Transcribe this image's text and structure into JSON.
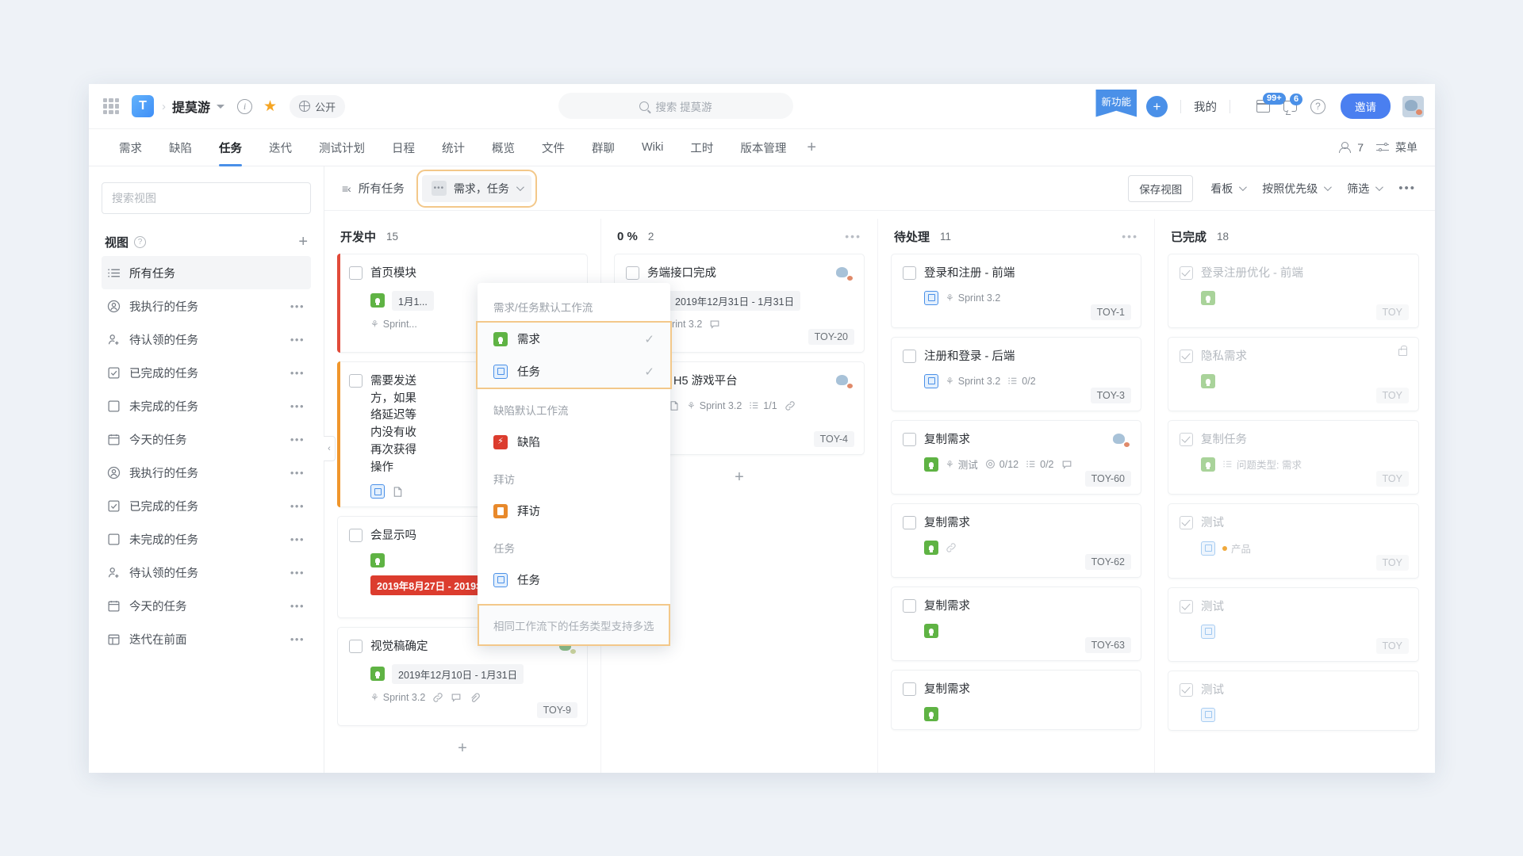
{
  "header": {
    "apps_icon": "grid-apps-icon",
    "project_logo": "T",
    "project_name": "提莫游",
    "info_icon": "i",
    "star_icon": "★",
    "visibility_label": "公开",
    "search_placeholder": "搜索 提莫游",
    "new_feature_badge": "新功能",
    "add_button": "+",
    "mine_label": "我的",
    "calendar_badge": "99+",
    "message_badge": "6",
    "help_icon": "?",
    "invite_label": "邀请"
  },
  "nav": {
    "tabs": [
      {
        "label": "需求",
        "active": false
      },
      {
        "label": "缺陷",
        "active": false
      },
      {
        "label": "任务",
        "active": true
      },
      {
        "label": "迭代",
        "active": false
      },
      {
        "label": "测试计划",
        "active": false
      },
      {
        "label": "日程",
        "active": false
      },
      {
        "label": "统计",
        "active": false
      },
      {
        "label": "概览",
        "active": false
      },
      {
        "label": "文件",
        "active": false
      },
      {
        "label": "群聊",
        "active": false
      },
      {
        "label": "Wiki",
        "active": false
      },
      {
        "label": "工时",
        "active": false
      },
      {
        "label": "版本管理",
        "active": false
      }
    ],
    "add_tab": "+",
    "member_count": "7",
    "menu_label": "菜单"
  },
  "sidebar": {
    "search_placeholder": "搜索视图",
    "section_title": "视图",
    "add_view": "+",
    "items": [
      {
        "label": "所有任务",
        "icon": "list-icon",
        "selected": true,
        "dots": ""
      },
      {
        "label": "我执行的任务",
        "icon": "user-circle-icon",
        "selected": false,
        "dots": "•••"
      },
      {
        "label": "待认领的任务",
        "icon": "user-plus-icon",
        "selected": false,
        "dots": "•••"
      },
      {
        "label": "已完成的任务",
        "icon": "checkbox-checked-icon",
        "selected": false,
        "dots": "•••"
      },
      {
        "label": "未完成的任务",
        "icon": "checkbox-empty-icon",
        "selected": false,
        "dots": "•••"
      },
      {
        "label": "今天的任务",
        "icon": "calendar-icon",
        "selected": false,
        "dots": "•••"
      },
      {
        "label": "我执行的任务",
        "icon": "user-circle-icon",
        "selected": false,
        "dots": "•••"
      },
      {
        "label": "已完成的任务",
        "icon": "checkbox-checked-icon",
        "selected": false,
        "dots": "•••"
      },
      {
        "label": "未完成的任务",
        "icon": "checkbox-empty-icon",
        "selected": false,
        "dots": "•••"
      },
      {
        "label": "待认领的任务",
        "icon": "user-plus-icon",
        "selected": false,
        "dots": "•••"
      },
      {
        "label": "今天的任务",
        "icon": "calendar-icon",
        "selected": false,
        "dots": "•••"
      },
      {
        "label": "迭代在前面",
        "icon": "layout-icon",
        "selected": false,
        "dots": "•••"
      }
    ]
  },
  "toolbar": {
    "collapse_icon": "≡‹",
    "view_title": "所有任务",
    "type_filter_label": "需求，任务",
    "save_view_label": "保存视图",
    "board_label": "看板",
    "sort_label": "按照优先级",
    "filter_label": "筛选",
    "more_label": "•••"
  },
  "dropdown": {
    "groups": [
      {
        "label": "需求/任务默认工作流",
        "highlighted": true,
        "items": [
          {
            "label": "需求",
            "icon": "bulb-icon",
            "color": "green",
            "checked": true
          },
          {
            "label": "任务",
            "icon": "checkbox-icon",
            "color": "blue",
            "checked": true
          }
        ]
      },
      {
        "label": "缺陷默认工作流",
        "highlighted": false,
        "items": [
          {
            "label": "缺陷",
            "icon": "bolt-icon",
            "color": "red",
            "checked": false
          }
        ]
      },
      {
        "label": "拜访",
        "highlighted": false,
        "items": [
          {
            "label": "拜访",
            "icon": "clipboard-icon",
            "color": "orange",
            "checked": false
          }
        ]
      },
      {
        "label": "任务",
        "highlighted": false,
        "items": [
          {
            "label": "任务",
            "icon": "checkbox-icon",
            "color": "blue",
            "checked": false
          }
        ]
      }
    ],
    "footer_note": "相同工作流下的任务类型支持多选"
  },
  "board": {
    "columns": [
      {
        "name": "开发中",
        "count": "15",
        "dots": "",
        "cards": [
          {
            "title": "首页模块",
            "stripe": "red",
            "type_icon": "bulb-icon",
            "type_color": "green",
            "date": "1月1...",
            "sprint": "Sprint...",
            "id": "",
            "done": false,
            "muted": false
          },
          {
            "title": "需要发送\n方，如果\n络延迟等\n内没有收\n再次获得\n操作",
            "stripe": "orange",
            "type_icon": "checkbox-icon",
            "type_color": "blue",
            "date": "",
            "sprint": "",
            "id": "",
            "done": false,
            "muted": false
          },
          {
            "title": "会显示吗",
            "stripe": "none",
            "type_icon": "bulb-icon",
            "type_color": "green",
            "date": "2019年8月27日 - 2019年8月31日",
            "date_overdue": true,
            "sprint": "",
            "id": "TOY-59",
            "done": false,
            "muted": false
          },
          {
            "title": "视觉稿确定",
            "stripe": "none",
            "type_icon": "bulb-icon",
            "type_color": "green",
            "date": "2019年12月10日 - 1月31日",
            "sprint": "Sprint 3.2",
            "extras": [
              "link-icon",
              "comment-icon",
              "attachment-icon"
            ],
            "avatar": "green",
            "id": "TOY-9",
            "done": false,
            "muted": false
          }
        ],
        "add_label": "+"
      },
      {
        "name": "0 %",
        "count": "2",
        "dots": "•••",
        "cards": [
          {
            "title": "务端接口完成",
            "stripe": "none",
            "type_icon": "bulb-icon",
            "type_color": "green",
            "date": "2019年12月31日 - 1月31日",
            "sprint": "Sprint 3.2",
            "extras": [
              "comment-icon"
            ],
            "avatar": "blue",
            "id": "TOY-20",
            "done": false,
            "muted": false
          },
          {
            "title": "调研 H5 游戏平台",
            "stripe": "none",
            "type_icon": "bulb-icon",
            "type_color": "green",
            "date": "",
            "sprint": "Sprint 3.2",
            "checklist": "1/1",
            "extras": [
              "doc-icon",
              "link-icon",
              "comment-icon"
            ],
            "avatar": "blue",
            "id": "TOY-4",
            "done": false,
            "muted": false
          }
        ],
        "add_label": "+"
      },
      {
        "name": "待处理",
        "count": "11",
        "dots": "•••",
        "cards": [
          {
            "title": "登录和注册 - 前端",
            "stripe": "none",
            "type_icon": "checkbox-icon",
            "type_color": "blue",
            "date": "",
            "sprint": "Sprint 3.2",
            "id": "TOY-1",
            "done": false,
            "muted": false
          },
          {
            "title": "注册和登录 - 后端",
            "stripe": "none",
            "type_icon": "checkbox-icon",
            "type_color": "blue",
            "date": "",
            "sprint": "Sprint 3.2",
            "checklist": "0/2",
            "id": "TOY-3",
            "done": false,
            "muted": false
          },
          {
            "title": "复制需求",
            "stripe": "none",
            "type_icon": "bulb-icon",
            "type_color": "green",
            "date": "",
            "sprint": "测试",
            "progress": "0/12",
            "checklist": "0/2",
            "extras": [
              "comment-icon"
            ],
            "avatar": "blue",
            "id": "TOY-60",
            "done": false,
            "muted": false
          },
          {
            "title": "复制需求",
            "stripe": "none",
            "type_icon": "bulb-icon",
            "type_color": "green",
            "date": "",
            "sprint": "",
            "extras": [
              "link-icon"
            ],
            "id": "TOY-62",
            "done": false,
            "muted": false
          },
          {
            "title": "复制需求",
            "stripe": "none",
            "type_icon": "bulb-icon",
            "type_color": "green",
            "date": "",
            "sprint": "",
            "id": "TOY-63",
            "done": false,
            "muted": false
          },
          {
            "title": "复制需求",
            "stripe": "none",
            "type_icon": "bulb-icon",
            "type_color": "green",
            "date": "",
            "sprint": "",
            "id": "",
            "done": false,
            "muted": false
          }
        ],
        "add_label": "+"
      },
      {
        "name": "已完成",
        "count": "18",
        "dots": "",
        "cards": [
          {
            "title": "登录注册优化 - 前端",
            "stripe": "none",
            "type_icon": "bulb-icon",
            "type_color": "green-pale",
            "date": "",
            "sprint": "",
            "id": "TOY",
            "done": true,
            "muted": true
          },
          {
            "title": "隐私需求",
            "stripe": "none",
            "type_icon": "bulb-icon",
            "type_color": "green-pale",
            "date": "",
            "sprint": "",
            "lock": true,
            "id": "TOY",
            "done": true,
            "muted": true
          },
          {
            "title": "复制任务",
            "stripe": "none",
            "type_icon": "bulb-icon",
            "type_color": "green-pale",
            "date": "",
            "sprint": "",
            "field_note": "问题类型: 需求",
            "id": "TOY",
            "done": true,
            "muted": true
          },
          {
            "title": "测试",
            "stripe": "none",
            "type_icon": "checkbox-icon",
            "type_color": "blue-pale",
            "date": "",
            "sprint": "",
            "tag": "产品",
            "id": "TOY",
            "done": true,
            "muted": true
          },
          {
            "title": "测试",
            "stripe": "none",
            "type_icon": "checkbox-icon",
            "type_color": "blue-pale",
            "date": "",
            "sprint": "",
            "id": "TOY",
            "done": true,
            "muted": true
          },
          {
            "title": "测试",
            "stripe": "none",
            "type_icon": "checkbox-icon",
            "type_color": "blue-pale",
            "date": "",
            "sprint": "",
            "id": "",
            "done": true,
            "muted": true
          }
        ],
        "add_label": "+"
      }
    ]
  },
  "colors": {
    "accent": "#4a90e8",
    "invite": "#4a7ff0",
    "green": "#5fb344",
    "red": "#dc3c2e",
    "orange": "#e8892b",
    "highlight_outline": "#f3c88a"
  }
}
